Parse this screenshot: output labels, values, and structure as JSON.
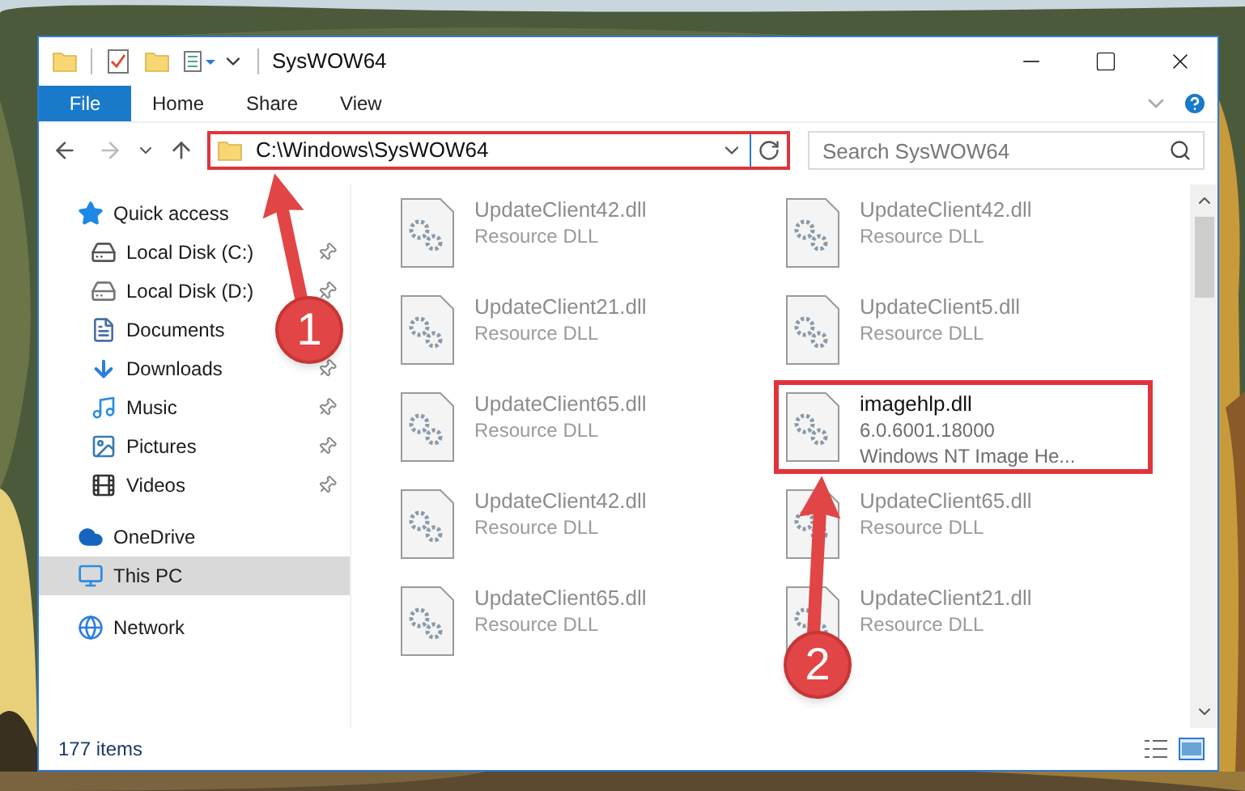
{
  "window": {
    "title": "SysWOW64"
  },
  "ribbon": {
    "tabs": [
      {
        "label": "File",
        "kind": "file"
      },
      {
        "label": "Home",
        "kind": "tab"
      },
      {
        "label": "Share",
        "kind": "tab"
      },
      {
        "label": "View",
        "kind": "tab"
      }
    ]
  },
  "address_bar": {
    "path": "C:\\Windows\\SysWOW64",
    "highlighted": true
  },
  "search": {
    "placeholder": "Search SysWOW64"
  },
  "navigation": [
    {
      "label": "Quick access",
      "kind": "star",
      "selected": false,
      "children": [
        {
          "label": "Local Disk (C:)",
          "kind": "system-drive",
          "pinned": true,
          "selected": false
        },
        {
          "label": "Local Disk (D:)",
          "kind": "drive",
          "pinned": true,
          "selected": false
        },
        {
          "label": "Documents",
          "kind": "documents",
          "pinned": false,
          "selected": false
        },
        {
          "label": "Downloads",
          "kind": "downloads",
          "pinned": true,
          "selected": false
        },
        {
          "label": "Music",
          "kind": "music",
          "pinned": true,
          "selected": false
        },
        {
          "label": "Pictures",
          "kind": "pictures",
          "pinned": true,
          "selected": false
        },
        {
          "label": "Videos",
          "kind": "videos",
          "pinned": true,
          "selected": false
        }
      ]
    },
    {
      "label": "OneDrive",
      "kind": "cloud",
      "selected": false
    },
    {
      "label": "This PC",
      "kind": "pc",
      "selected": true
    },
    {
      "label": "Network",
      "kind": "network",
      "selected": false
    }
  ],
  "files": [
    {
      "name": "UpdateClient42.dll",
      "details": [
        "Resource DLL"
      ],
      "blurred": true,
      "highlighted": false
    },
    {
      "name": "UpdateClient42.dll",
      "details": [
        "Resource DLL"
      ],
      "blurred": true,
      "highlighted": false
    },
    {
      "name": "UpdateClient21.dll",
      "details": [
        "Resource DLL"
      ],
      "blurred": true,
      "highlighted": false
    },
    {
      "name": "UpdateClient5.dll",
      "details": [
        "Resource DLL"
      ],
      "blurred": true,
      "highlighted": false
    },
    {
      "name": "UpdateClient65.dll",
      "details": [
        "Resource DLL"
      ],
      "blurred": true,
      "highlighted": false
    },
    {
      "name": "imagehlp.dll",
      "details": [
        "6.0.6001.18000",
        "Windows NT Image He..."
      ],
      "blurred": false,
      "highlighted": true
    },
    {
      "name": "UpdateClient42.dll",
      "details": [
        "Resource DLL"
      ],
      "blurred": true,
      "highlighted": false
    },
    {
      "name": "UpdateClient65.dll",
      "details": [
        "Resource DLL"
      ],
      "blurred": true,
      "highlighted": false
    },
    {
      "name": "UpdateClient65.dll",
      "details": [
        "Resource DLL"
      ],
      "blurred": true,
      "highlighted": false
    },
    {
      "name": "UpdateClient21.dll",
      "details": [
        "Resource DLL"
      ],
      "blurred": true,
      "highlighted": false
    }
  ],
  "status_bar": {
    "item_count": "177 items"
  },
  "annotations": [
    {
      "label": "1"
    },
    {
      "label": "2"
    }
  ]
}
